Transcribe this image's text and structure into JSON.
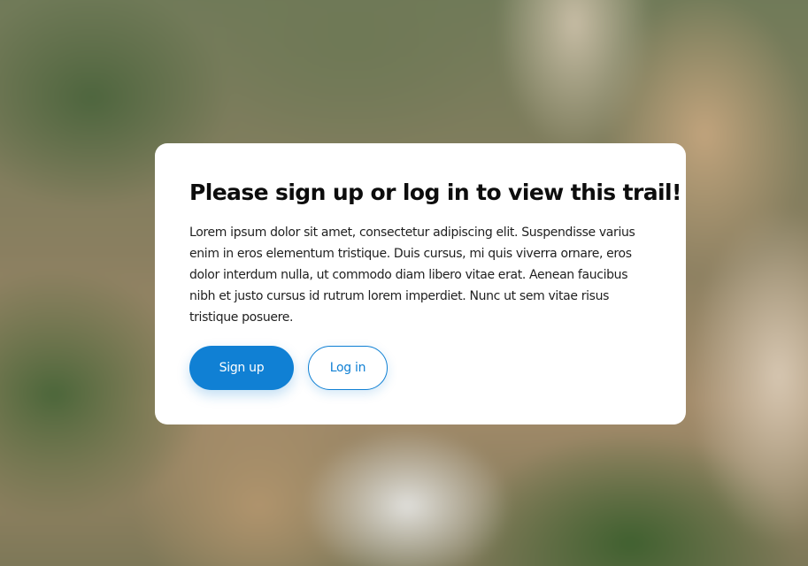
{
  "modal": {
    "title": "Please sign up or log in to view this trail!",
    "body": "Lorem ipsum dolor sit amet, consectetur adipiscing elit. Suspendisse varius enim in eros elementum tristique. Duis cursus, mi quis viverra ornare, eros dolor interdum nulla, ut commodo diam libero vitae erat. Aenean faucibus nibh et justo cursus id rutrum lorem imperdiet. Nunc ut sem vitae risus tristique posuere.",
    "sign_up_label": "Sign up",
    "log_in_label": "Log in"
  },
  "colors": {
    "accent": "#1080d4",
    "card_background": "#ffffff",
    "title_text": "#0d0d0d"
  }
}
